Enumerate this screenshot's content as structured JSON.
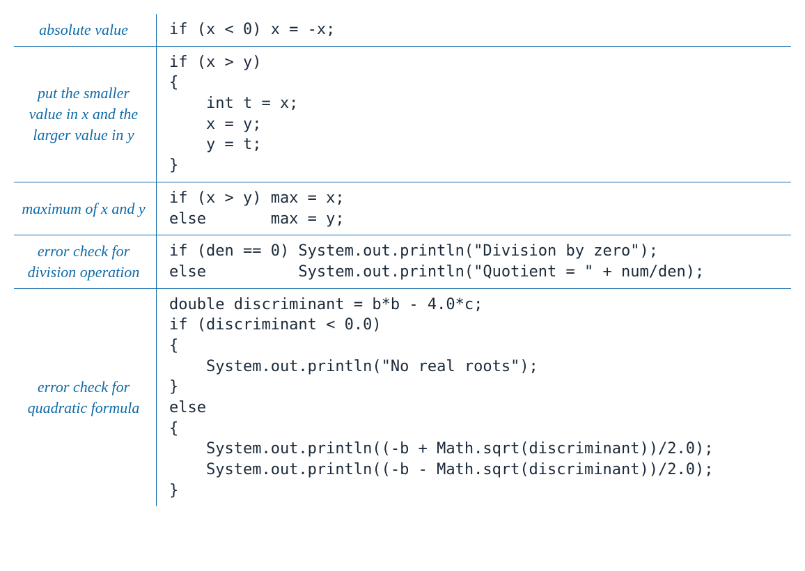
{
  "rows": [
    {
      "desc": "absolute value",
      "code": "if (x < 0) x = -x;"
    },
    {
      "desc": "put the smaller\nvalue in x\nand the larger\nvalue in y",
      "code": "if (x > y)\n{\n    int t = x;\n    x = y;\n    y = t;\n}"
    },
    {
      "desc": "maximum of\nx and y",
      "code": "if (x > y) max = x;\nelse       max = y;"
    },
    {
      "desc": "error check\nfor division\noperation",
      "code": "if (den == 0) System.out.println(\"Division by zero\");\nelse          System.out.println(\"Quotient = \" + num/den);"
    },
    {
      "desc": "error check\nfor quadratic\nformula",
      "code": "double discriminant = b*b - 4.0*c;\nif (discriminant < 0.0)\n{\n    System.out.println(\"No real roots\");\n}\nelse\n{\n    System.out.println((-b + Math.sqrt(discriminant))/2.0);\n    System.out.println((-b - Math.sqrt(discriminant))/2.0);\n}"
    }
  ]
}
